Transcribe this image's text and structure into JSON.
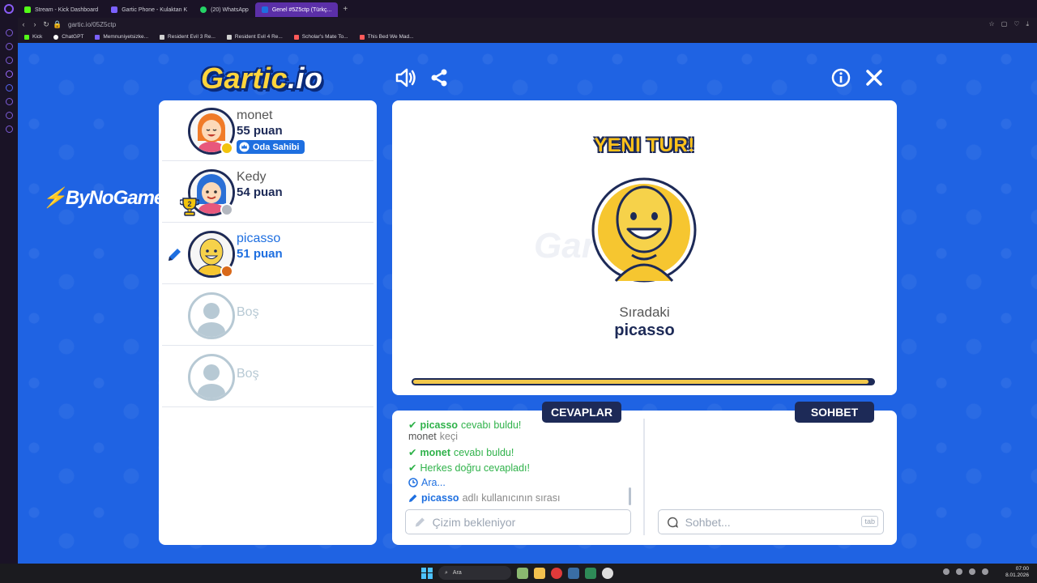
{
  "browser": {
    "tabs": [
      {
        "label": "Stream - Kick Dashboard",
        "color": "#53fc18"
      },
      {
        "label": "Gartic Phone - Kulaktan K",
        "color": "#7b61ff"
      },
      {
        "label": "(20) WhatsApp",
        "color": "#25d366"
      },
      {
        "label": "Genel #5Z5ctp (Türkç...",
        "color": "#1e6fe0",
        "active": true
      }
    ],
    "url": "gartic.io/05Z5ctp",
    "bookmarks": [
      {
        "label": "Kick",
        "color": "#53fc18"
      },
      {
        "label": "ChatGPT",
        "color": "#ffffff"
      },
      {
        "label": "Memnuniyetsizke...",
        "color": "#7b61ff"
      },
      {
        "label": "Resident Evil 3 Re...",
        "color": "#d0d0d0"
      },
      {
        "label": "Resident Evil 4 Re...",
        "color": "#d0d0d0"
      },
      {
        "label": "Scholar's Mate To...",
        "color": "#ff5a5a"
      },
      {
        "label": "This Bed We Mad...",
        "color": "#ff5a5a"
      }
    ]
  },
  "game": {
    "logo_main": "Gartic",
    "logo_suffix": ".io",
    "sponsor": "ByNoGame",
    "players": [
      {
        "name": "monet",
        "score": "55 puan",
        "badge": "Oda Sahibi",
        "dot_color": "#f2c30c",
        "hair": "#f07b28",
        "shirt": "#e8577c",
        "rank_icon": ""
      },
      {
        "name": "Kedy",
        "score": "54 puan",
        "badge": "",
        "dot_color": "#b3b7bf",
        "hair": "#2a6fd6",
        "shirt": "#e8577c",
        "rank_icon": "2"
      },
      {
        "name": "picasso",
        "score": "51 puan",
        "badge": "",
        "dot_color": "#d9691a",
        "hair": "#f6c630",
        "shirt": "#f6c630",
        "rank_icon": "pencil"
      }
    ],
    "empty_slots": [
      "Boş",
      "Boş"
    ],
    "stage": {
      "heading": "YENI TUR!",
      "watermark": "Gartic.io",
      "next_label": "Sıradaki",
      "next_name": "picasso",
      "progress": 0.99
    },
    "tabs": {
      "answers": "CEVAPLAR",
      "chat": "SOHBET"
    },
    "messages": [
      {
        "type": "green",
        "user": "picasso",
        "text": "cevabı buldu!"
      },
      {
        "type": "plain",
        "user": "monet",
        "text": "keçi"
      },
      {
        "type": "green",
        "user": "monet",
        "text": "cevabı buldu!"
      },
      {
        "type": "green",
        "user": "",
        "text": "Herkes doğru cevapladı!"
      },
      {
        "type": "blue-clock",
        "user": "",
        "text": "Ara..."
      },
      {
        "type": "blue-pencil",
        "user": "picasso",
        "text": "adlı kullanıcının sırası"
      }
    ],
    "answer_placeholder": "Çizim bekleniyor",
    "chat_placeholder": "Sohbet...",
    "tab_key": "tab"
  },
  "taskbar": {
    "search": "Ara",
    "time": "07:00",
    "date": "8.01.2026"
  }
}
